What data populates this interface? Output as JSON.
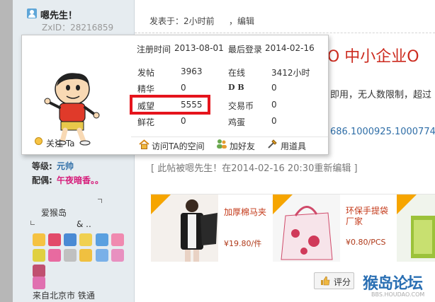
{
  "user": {
    "name": "嗯先生！",
    "zxid": "ZxID：28216859"
  },
  "post_meta": {
    "posted": "发表于：2小时前",
    "edit": "，编辑"
  },
  "post": {
    "title_visible": "O 中小企业O",
    "line1_visible": "即用，无人数限制，超过",
    "link_visible": "686.1000925.1000774.2",
    "edit_note": "[ 此帖被嗯先生！在2014-02-16 20:30重新编辑 ]"
  },
  "popup": {
    "register_label": "注册时间",
    "register_date": "2013-08-01",
    "lastlogin_label": "最后登录",
    "lastlogin_date": "2014-02-16",
    "stats": [
      {
        "label": "发帖",
        "value": "3963"
      },
      {
        "label": "精华",
        "value": "0"
      },
      {
        "label": "威望",
        "value": "5555"
      },
      {
        "label": "鲜花",
        "value": "0"
      }
    ],
    "stats2": [
      {
        "label": "在线",
        "value": "3412小时"
      },
      {
        "label": "D B",
        "value": "0"
      },
      {
        "label": "交易币",
        "value": "0"
      },
      {
        "label": "鸡蛋",
        "value": "0"
      }
    ],
    "follow": "关注 Ta",
    "actions": [
      "访问TA的空间",
      "加好友",
      "用道具"
    ]
  },
  "sidebar": {
    "level_label": "等级:",
    "level_value": "元帅",
    "spouse_label": "配偶:",
    "spouse_value": "午夜暗香。。",
    "island": "爱猴岛",
    "island_amp": "& ..",
    "from": "来自北京市 铁通"
  },
  "ads": [
    {
      "title": "加厚棉马夹",
      "price": "¥19.80/件"
    },
    {
      "title": "环保手提袋厂家",
      "price": "¥0.80/PCS"
    }
  ],
  "buttons": {
    "rate": "评分"
  },
  "watermark": {
    "main": "猴岛论坛",
    "sub": "BBS.HOUDAO.COM"
  },
  "colors": {
    "highlight": "#e5141c",
    "link": "#2f6ea7",
    "title_red": "#cc2b1f"
  }
}
